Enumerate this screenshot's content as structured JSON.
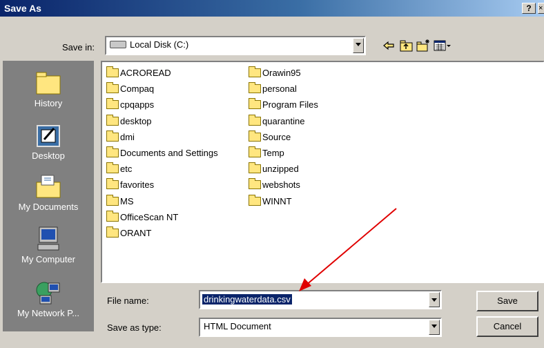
{
  "window": {
    "title": "Save As",
    "help_glyph": "?",
    "close_glyph": "×"
  },
  "toolbar": {
    "save_in_label": "Save in:",
    "save_in_value": "Local Disk (C:)",
    "buttons": [
      "back-icon",
      "up-one-level-icon",
      "create-new-folder-icon",
      "view-menu-icon"
    ]
  },
  "places": [
    {
      "label": "History",
      "icon": "history-icon"
    },
    {
      "label": "Desktop",
      "icon": "desktop-icon"
    },
    {
      "label": "My Documents",
      "icon": "my-documents-icon"
    },
    {
      "label": "My Computer",
      "icon": "my-computer-icon"
    },
    {
      "label": "My Network P...",
      "icon": "my-network-places-icon"
    }
  ],
  "files": {
    "column1": [
      "ACROREAD",
      "Compaq",
      "cpqapps",
      "desktop",
      "dmi",
      "Documents and Settings",
      "etc",
      "favorites",
      "MS",
      "OfficeScan NT",
      "ORANT"
    ],
    "column2": [
      "Orawin95",
      "personal",
      "Program Files",
      "quarantine",
      "Source",
      "Temp",
      "unzipped",
      "webshots",
      "WINNT"
    ]
  },
  "form": {
    "file_name_label": "File name:",
    "file_name_value": "drinkingwaterdata.csv",
    "save_type_label": "Save as type:",
    "save_type_value": "HTML Document"
  },
  "buttons": {
    "save": "Save",
    "cancel": "Cancel"
  },
  "colors": {
    "title_bar": "#0a246a",
    "dialog_bg": "#d4d0c8",
    "places_bar": "#808080",
    "selection": "#0a246a",
    "annotation_arrow": "#e00000"
  }
}
